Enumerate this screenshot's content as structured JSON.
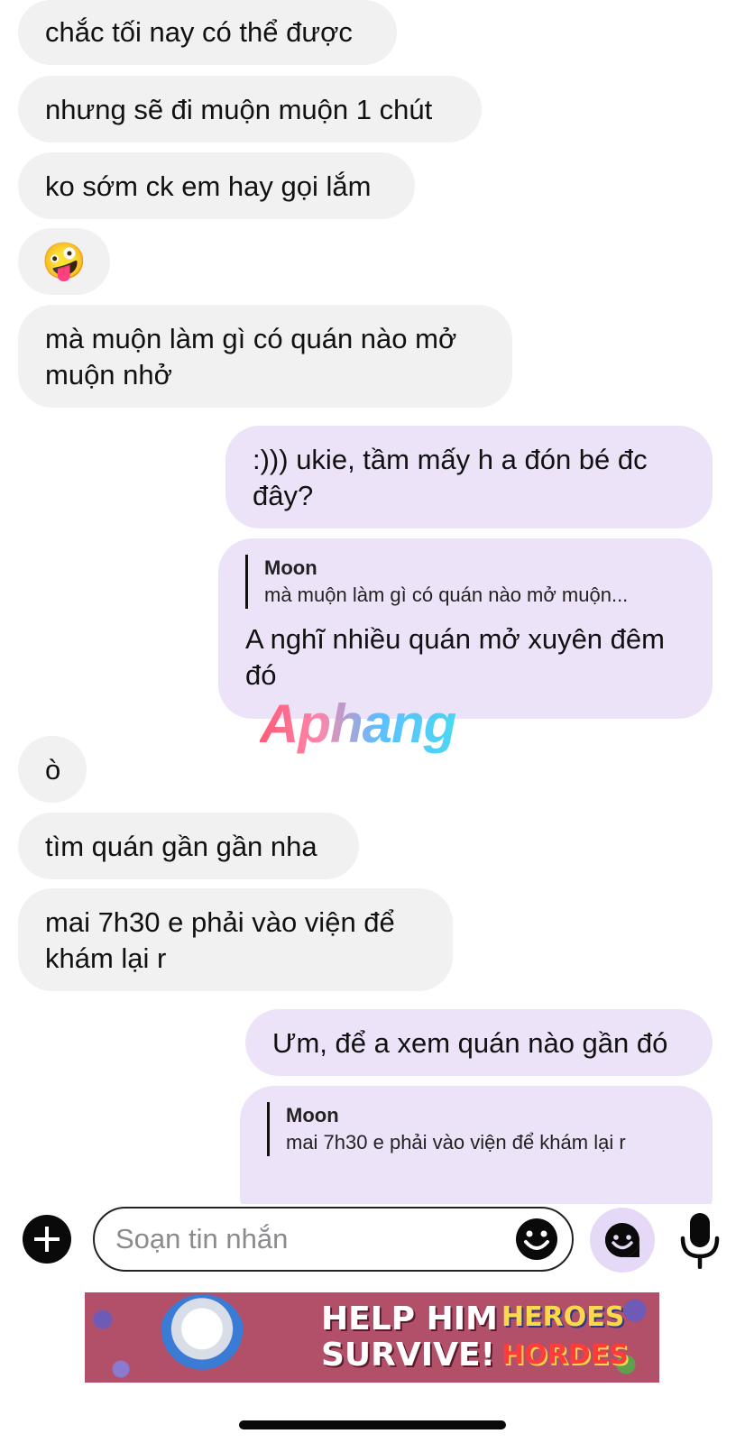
{
  "messages": [
    {
      "text": "chắc tối nay có thể được"
    },
    {
      "text": "nhưng sẽ đi muộn muộn 1 chút"
    },
    {
      "text": "ko sớm ck em hay gọi lắm"
    },
    {
      "text": "🤪"
    },
    {
      "text": "mà muộn làm gì có quán nào mở muộn nhở"
    },
    {
      "text": ":))) ukie, tầm mấy h a đón bé đc đây?"
    },
    {
      "reply_name": "Moon",
      "reply_quote": "mà muộn làm gì có quán nào mở muộn...",
      "text": "A nghĩ nhiều quán mở xuyên đêm đó"
    },
    {
      "text": "ò"
    },
    {
      "text": "tìm quán gần gần nha"
    },
    {
      "text": "mai 7h30 e phải vào viện để khám lại r"
    },
    {
      "text": "Ưm, để a xem quán nào gần đó"
    },
    {
      "reply_name": "Moon",
      "reply_quote": "mai 7h30 e phải vào viện để khám lại r"
    }
  ],
  "watermark": "Aphang",
  "composer": {
    "placeholder": "Soạn tin nhắn",
    "icons": [
      "plus-icon",
      "emoji-icon",
      "sticker-icon",
      "microphone-icon"
    ]
  },
  "ad": {
    "headline_line1": "HELP HIM",
    "headline_line2": "SURVIVE!",
    "brand_line1": "HEROES",
    "brand_line2": "HORDES"
  },
  "colors": {
    "incoming_bubble": "#f1f1f2",
    "outgoing_bubble": "#ece3f9",
    "sticker_button": "#e6d9f7"
  }
}
